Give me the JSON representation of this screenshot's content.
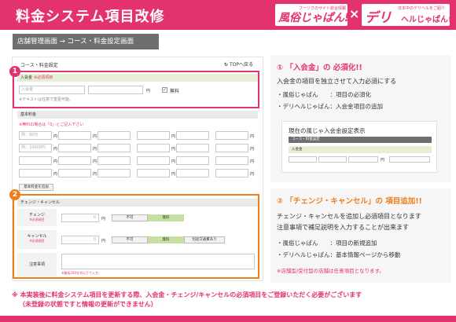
{
  "header": {
    "title": "料金システム項目改修",
    "logo1": {
      "small": "フーゾクのサイト総合情報",
      "main": "風俗じゃぱん!"
    },
    "logo_separator": "×",
    "logo2": {
      "small": "日本中のデリヘルをご紹介",
      "main": "デリ",
      "sub": "ヘルじゃぱん!"
    }
  },
  "breadcrumb": "店舗管理画面 → コース・料金設定画面",
  "screenshot": {
    "title": "コース・料金設定",
    "top_link": "TOPへ戻る",
    "top_link_icon": "refresh-arrow-icon",
    "badge1": "1",
    "badge2": "2",
    "entry": {
      "label": "入会金",
      "required": "※必須項目",
      "input_placeholder": "入会金",
      "unit": "円",
      "free_label": "無料",
      "free_checked": true,
      "note": "※テキストは任意で変更可能。"
    },
    "basic": {
      "label": "基本料金",
      "note": "※無料の場合は「0」とご記入下さい",
      "placeholder_a": "例：60分",
      "placeholder_b": "例：10000円",
      "unit": "円",
      "add_button": "基本料金を追加"
    },
    "change": {
      "section_label": "チェンジ・キャンセル",
      "change_label": "チェンジ",
      "change_req": "※必須項目",
      "change_value": "0",
      "unit": "円",
      "btn_not": "不可",
      "btn_free": "無料",
      "cancel_label": "キャンセル",
      "cancel_req": "※必須項目",
      "cancel_value": "0",
      "btn_fare": "別途交通費あり",
      "notes_label": "注意事項",
      "notes_hint": "※最長200文字以下で入力"
    }
  },
  "panel1": {
    "num": "①",
    "title": "「入会金」の",
    "title2": "必須化!!",
    "desc": "入会金の項目を独立させて入力必須にする",
    "bullets": [
      "・風俗じゃぱん　　：項目の必須化",
      "・デリヘルじゃぱん：入会金項目の追加"
    ],
    "inset_title": "現在の風じゃ入会金設定表示",
    "inset_bar": "コース・料金設定",
    "inset_label": "入会金",
    "inset_field_a": "",
    "inset_field_b": "",
    "inset_unit": "円"
  },
  "panel2": {
    "num": "②",
    "title": "「チェンジ・キャンセル」の",
    "title2": "項目追加!!",
    "desc1": "チェンジ・キャンセルを追加し必須項目となります",
    "desc2": "注意事項で補足説明を入力することが出来ます",
    "bullets": [
      "・風俗じゃぱん　　：項目の新規追加",
      "・デリヘルじゃぱん：基本情報ページから移動"
    ],
    "note": "※店舗型/受付型の店舗は任意項目となります。"
  },
  "footer": {
    "line1": "※ 本実装後に料金システム項目を更新する際、入会金・チェンジ/キャンセルの必須項目をご登録いただく必要がございます",
    "line2": "（未登録の状態ですと情報の更新ができません）"
  }
}
